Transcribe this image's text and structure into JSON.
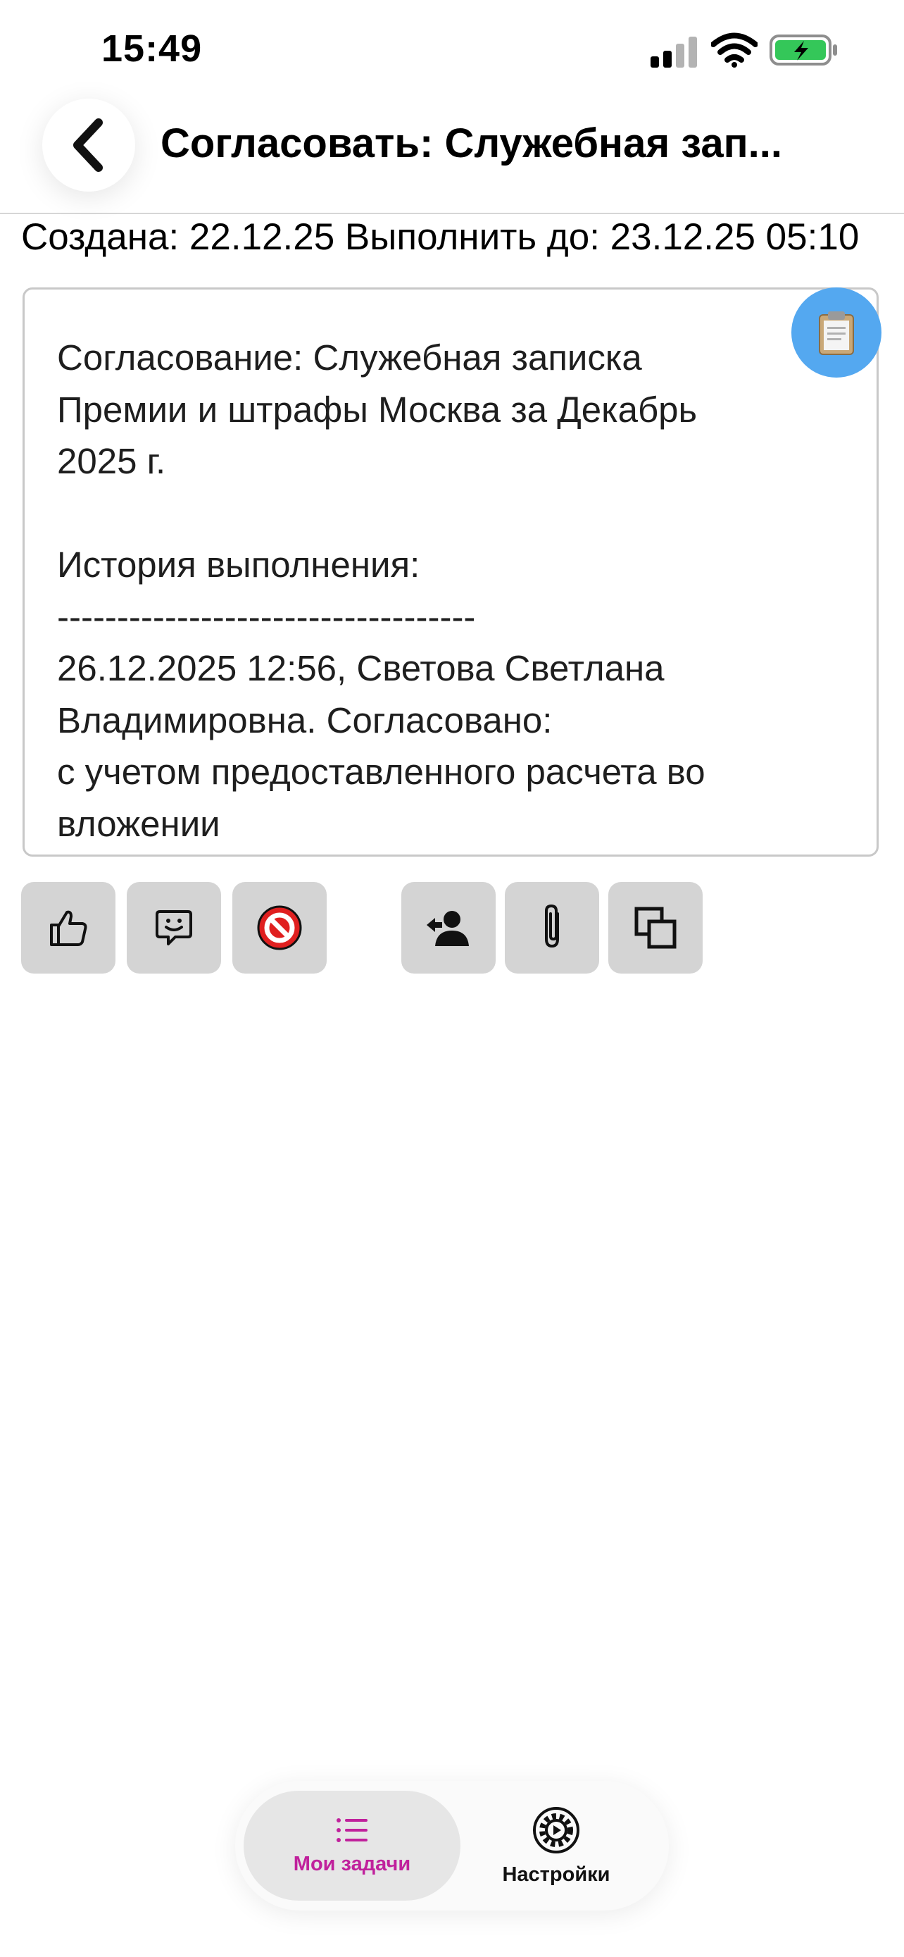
{
  "status_bar": {
    "time": "15:49"
  },
  "header": {
    "title": "Согласовать: Служебная зап..."
  },
  "meta": {
    "dates": "Создана: 22.12.25 Выполнить до: 23.12.25 05:10"
  },
  "task": {
    "text": "Согласование: Служебная записка\nПремии и штрафы Москва за Декабрь\n2025 г.\n\nИстория выполнения:\n-----------------------------------\n26.12.2025 12:56, Светова Светлана\nВладимировна. Согласовано:\nс учетом предоставленного расчета  во\nвложении"
  },
  "actions": [
    {
      "icon": "thumbs-up-icon"
    },
    {
      "icon": "comment-smile-icon"
    },
    {
      "icon": "reject-icon"
    },
    {
      "icon": "delegate-user-icon"
    },
    {
      "icon": "paperclip-icon"
    },
    {
      "icon": "copy-icon"
    }
  ],
  "tabbar": {
    "tabs": [
      {
        "label": "Мои задачи",
        "icon": "list-icon",
        "active": true
      },
      {
        "label": "Настройки",
        "icon": "settings-gear-icon",
        "active": false
      }
    ]
  },
  "colors": {
    "accent_tab": "#c0219c",
    "copy_button": "#54a8f0",
    "battery_green": "#34c759",
    "reject_red": "#e02020"
  }
}
